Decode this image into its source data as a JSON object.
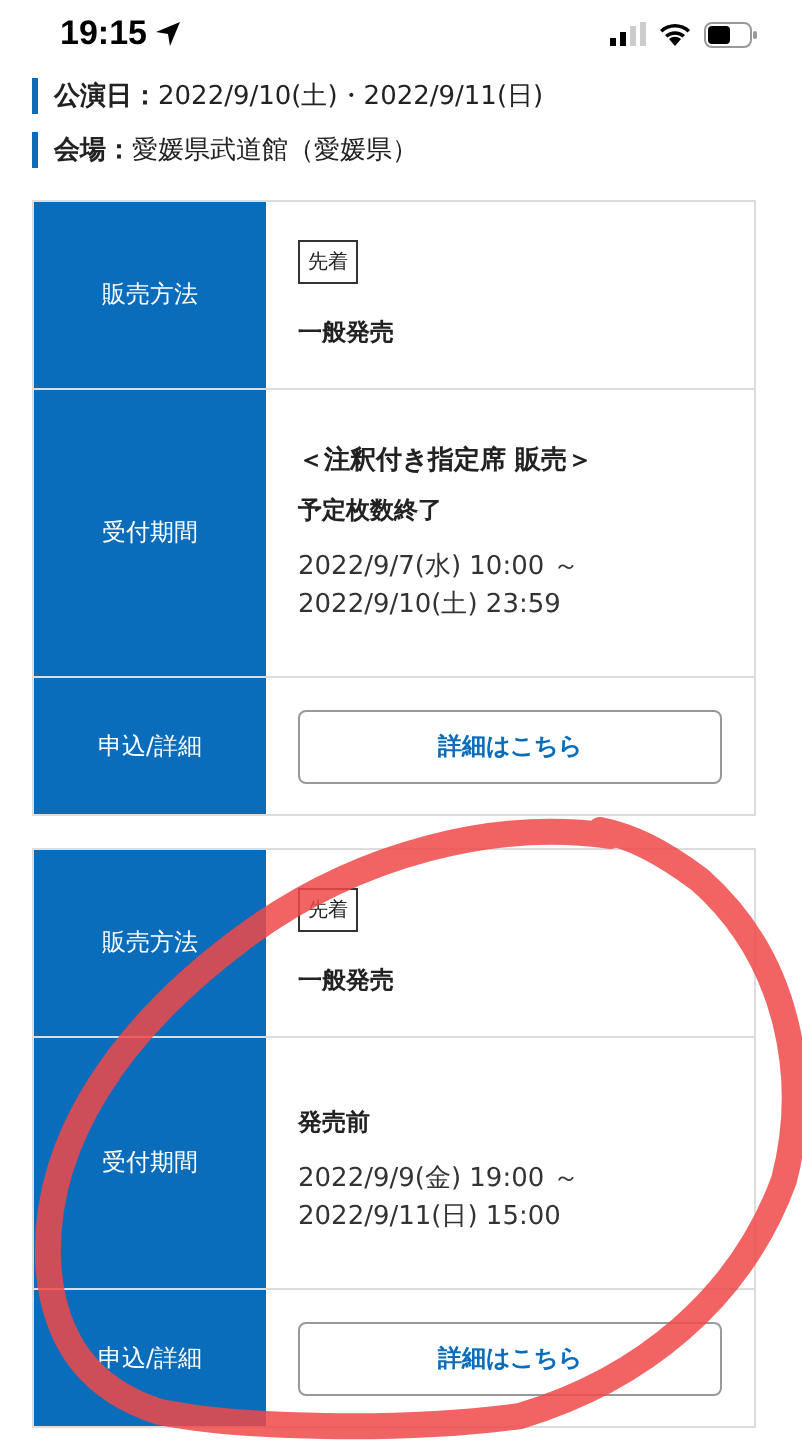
{
  "status_bar": {
    "time": "19:15"
  },
  "event_info": [
    "**公演日：**2022/9/10(土)・2022/9/11(日)",
    "**会場：**愛媛県武道館（愛媛県）"
  ],
  "sales": [
    {
      "rows": [
        {
          "kind": "method",
          "label": "販売方法",
          "badge": "先着",
          "text": "一般発売"
        },
        {
          "kind": "period",
          "label": "受付期間",
          "title": "＜注釈付き指定席 販売＞",
          "status": "予定枚数終了",
          "dates": [
            "2022/9/7(水) 10:00 ～",
            "2022/9/10(土) 23:59"
          ]
        },
        {
          "kind": "apply",
          "label": "申込/詳細",
          "button": "詳細はこちら"
        }
      ]
    },
    {
      "rows": [
        {
          "kind": "method",
          "label": "販売方法",
          "badge": "先着",
          "text": "一般発売"
        },
        {
          "kind": "period",
          "label": "受付期間",
          "status": "発売前",
          "dates": [
            "2022/9/9(金) 19:00 ～",
            "2022/9/11(日) 15:00"
          ]
        },
        {
          "kind": "apply",
          "label": "申込/詳細",
          "button": "詳細はこちら"
        }
      ]
    }
  ],
  "annotation": {
    "kind": "pen-circle"
  }
}
